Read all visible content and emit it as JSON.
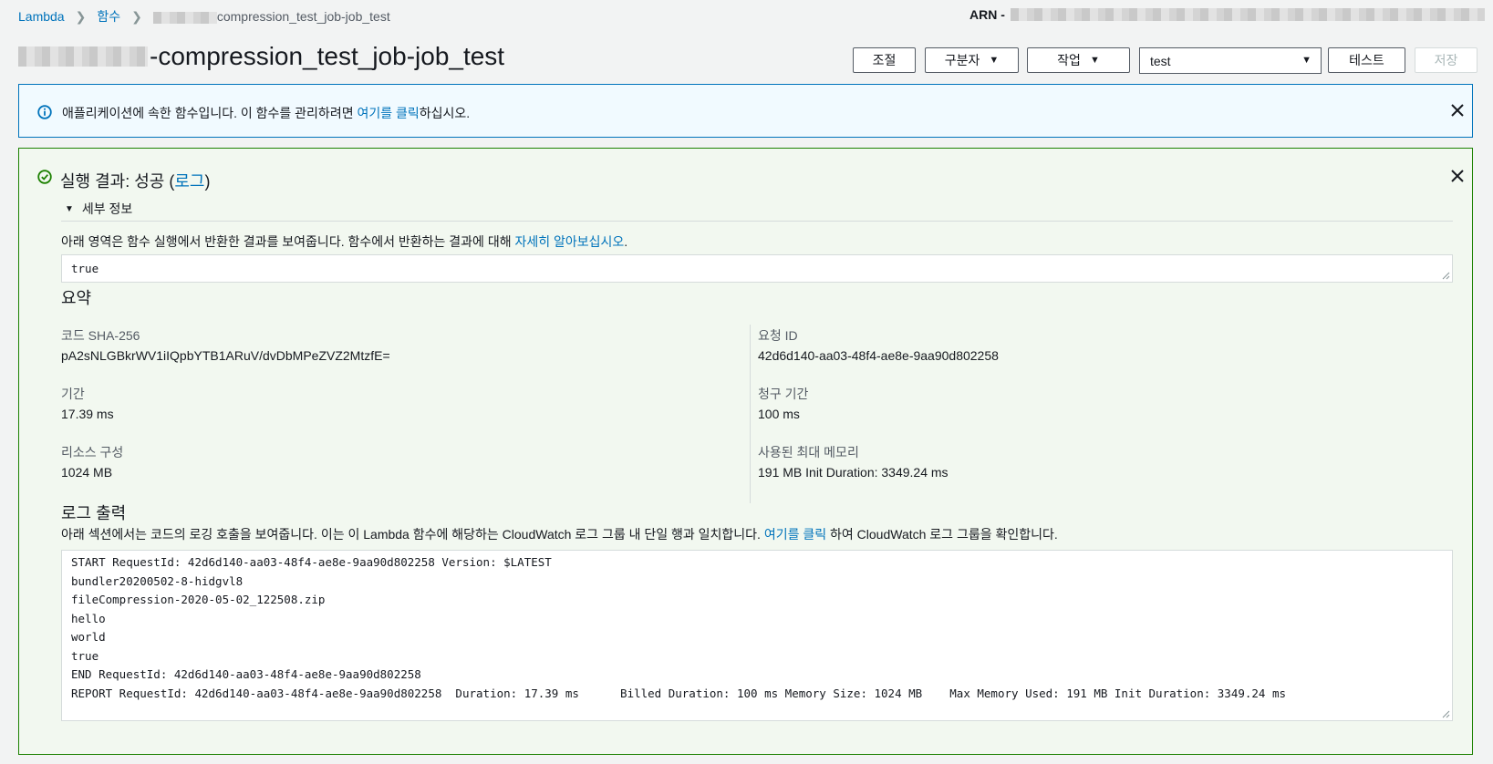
{
  "breadcrumb": {
    "root": "Lambda",
    "functions": "함수",
    "current_suffix": "compression_test_job-job_test"
  },
  "arn_label": "ARN -",
  "header": {
    "title_suffix": "-compression_test_job-job_test",
    "throttle_label": "조절",
    "qualifier_label": "구분자",
    "actions_label": "작업",
    "test_event_value": "test",
    "test_label": "테스트",
    "save_label": "저장"
  },
  "info_banner": {
    "text_before": "애플리케이션에 속한 함수입니다. 이 함수를 관리하려면 ",
    "link": "여기를 클릭",
    "text_after": "하십시오."
  },
  "result": {
    "title_prefix": "실행 결과: 성공 (",
    "title_link": "로그",
    "title_suffix": ")",
    "details_label": "세부 정보",
    "return_desc_before": "아래 영역은 함수 실행에서 반환한 결과를 보여줍니다. 함수에서 반환하는 결과에 대해 ",
    "return_desc_link": "자세히 알아보십시오",
    "return_desc_after": ".",
    "return_value": "true",
    "summary_heading": "요약",
    "summary": {
      "code_sha_label": "코드 SHA-256",
      "code_sha_value": "pA2sNLGBkrWV1iIQpbYTB1ARuV/dvDbMPeZVZ2MtzfE=",
      "request_id_label": "요청 ID",
      "request_id_value": "42d6d140-aa03-48f4-ae8e-9aa90d802258",
      "duration_label": "기간",
      "duration_value": "17.39 ms",
      "billed_label": "청구 기간",
      "billed_value": "100 ms",
      "resources_label": "리소스 구성",
      "resources_value": "1024 MB",
      "max_mem_label": "사용된 최대 메모리",
      "max_mem_value": "191 MB Init Duration: 3349.24 ms"
    },
    "log_heading": "로그 출력",
    "log_desc_before": "아래 섹션에서는 코드의 로깅 호출을 보여줍니다. 이는 이 Lambda 함수에 해당하는 CloudWatch 로그 그룹 내 단일 행과 일치합니다. ",
    "log_desc_link": "여기를 클릭",
    "log_desc_after": " 하여 CloudWatch 로그 그룹을 확인합니다.",
    "log_lines": [
      "START RequestId: 42d6d140-aa03-48f4-ae8e-9aa90d802258 Version: $LATEST",
      "bundler20200502-8-hidgvl8",
      "fileCompression-2020-05-02_122508.zip",
      "hello",
      "world",
      "true",
      "END RequestId: 42d6d140-aa03-48f4-ae8e-9aa90d802258",
      "REPORT RequestId: 42d6d140-aa03-48f4-ae8e-9aa90d802258  Duration: 17.39 ms      Billed Duration: 100 ms Memory Size: 1024 MB    Max Memory Used: 191 MB Init Duration: 3349.24 ms"
    ]
  },
  "icons": {
    "info": "info-circle-icon",
    "success": "check-circle-icon",
    "close": "close-icon",
    "caret": "caret-down-icon",
    "chevron": "chevron-right-icon"
  },
  "colors": {
    "link": "#0073bb",
    "info_border": "#0073bb",
    "success_border": "#1d8102",
    "success_bg": "#f2f8f0"
  }
}
